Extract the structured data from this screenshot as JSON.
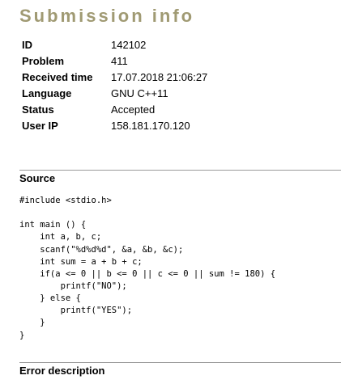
{
  "header": {
    "title": "Submission info"
  },
  "submission": {
    "rows": [
      {
        "key": "ID",
        "value": "142102"
      },
      {
        "key": "Problem",
        "value": "411"
      },
      {
        "key": "Received time",
        "value": "17.07.2018 21:06:27"
      },
      {
        "key": "Language",
        "value": "GNU C++11"
      },
      {
        "key": "Status",
        "value": "Accepted"
      },
      {
        "key": "User IP",
        "value": "158.181.170.120"
      }
    ]
  },
  "source": {
    "heading": "Source",
    "lines": [
      "#include <stdio.h>",
      "",
      "int main () {",
      "    int a, b, c;",
      "    scanf(\"%d%d%d\", &a, &b, &c);",
      "    int sum = a + b + c;",
      "    if(a <= 0 || b <= 0 || c <= 0 || sum != 180) {",
      "        printf(\"NO\");",
      "    } else {",
      "        printf(\"YES\");",
      "    }",
      "}"
    ]
  },
  "error": {
    "heading": "Error description"
  },
  "colors": {
    "title": "#a09a73",
    "divider": "#9a9a9a"
  }
}
